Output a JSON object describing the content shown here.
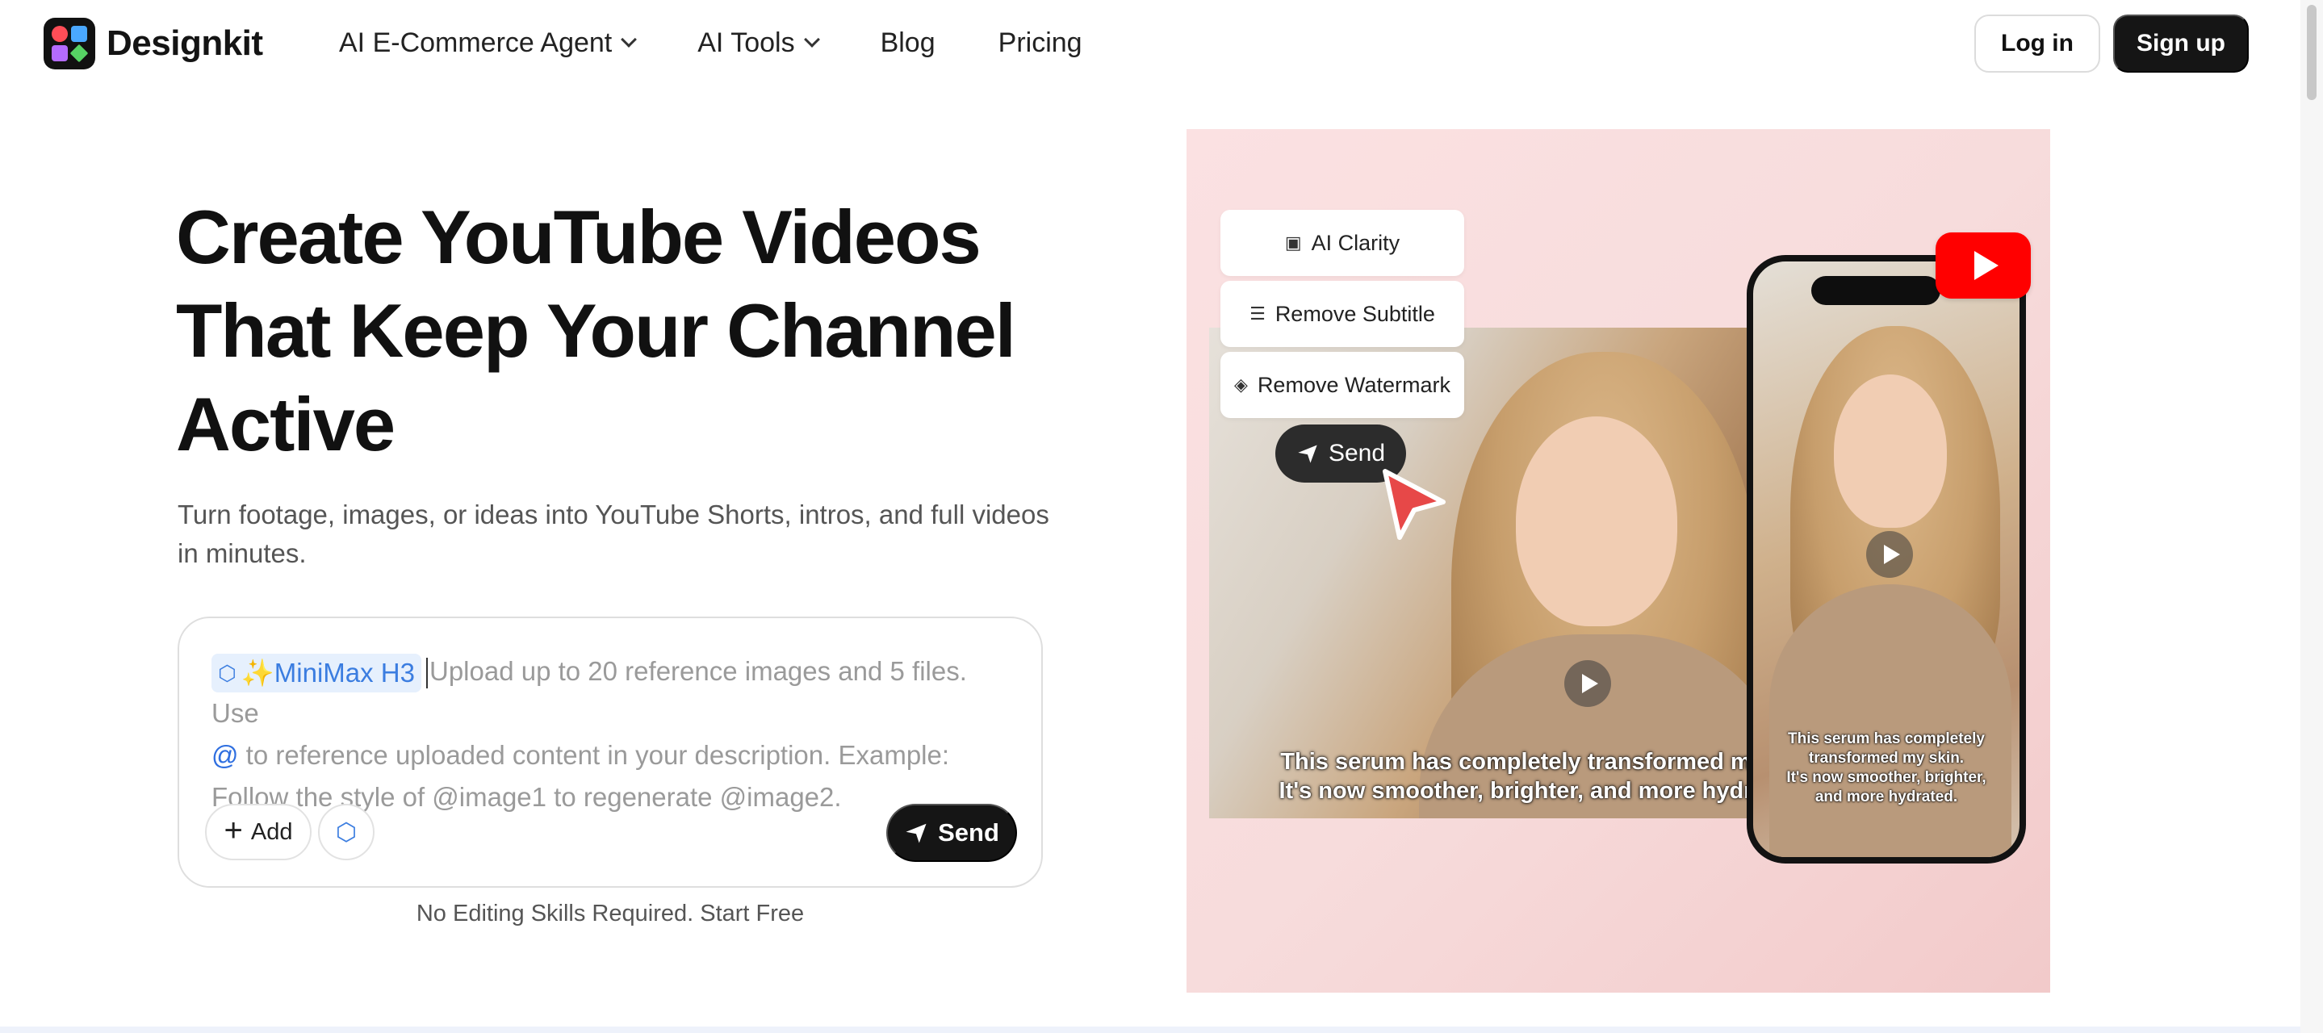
{
  "brand": {
    "name": "Designkit"
  },
  "nav": {
    "items": [
      {
        "label": "AI E-Commerce Agent",
        "has_dropdown": true
      },
      {
        "label": "AI Tools",
        "has_dropdown": true
      },
      {
        "label": "Blog",
        "has_dropdown": false
      },
      {
        "label": "Pricing",
        "has_dropdown": false
      }
    ],
    "login": "Log in",
    "signup": "Sign up"
  },
  "hero": {
    "title_line1": "Create YouTube Videos",
    "title_line2": "That Keep Your Channel",
    "title_line3": "Active",
    "subtitle": "Turn footage, images, or ideas into YouTube Shorts, intros, and full videos in minutes.",
    "prompt": {
      "model_chip": "✨MiniMax H3",
      "placeholder_part1": "Upload up to 20 reference images and 5 files. Use",
      "at_symbol": "@",
      "placeholder_part2": "to reference uploaded content in your description. Example: Follow the style of @image1 to regenerate @image2.",
      "add_label": "Add",
      "send_label": "Send"
    },
    "note": "No Editing Skills Required. Start Free"
  },
  "media": {
    "tools": [
      {
        "label": "AI Clarity",
        "icon": "hd-icon"
      },
      {
        "label": "Remove Subtitle",
        "icon": "sliders-icon"
      },
      {
        "label": "Remove Watermark",
        "icon": "layers-icon"
      }
    ],
    "send_label": "Send",
    "subtitle_line1": "This serum has completely transformed m",
    "subtitle_line2": "It's now smoother, brighter, and more hydr",
    "phone_sub_line1": "This serum has completely",
    "phone_sub_line2": "transformed my skin.",
    "phone_sub_line3": "It's now smoother, brighter,",
    "phone_sub_line4": "and more hydrated."
  },
  "colors": {
    "accent_dark": "#151515",
    "chip_bg": "#e6f0fd",
    "chip_text": "#3b7de0",
    "youtube_red": "#ff0000",
    "media_bg": "#f7dcdc"
  }
}
